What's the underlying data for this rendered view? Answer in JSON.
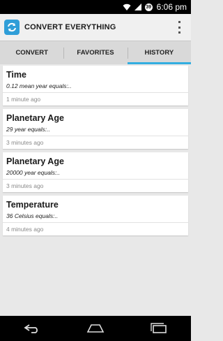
{
  "status_bar": {
    "battery_level": "39",
    "time": "6:06 pm"
  },
  "app": {
    "title": "CONVERT EVERYTHING",
    "accent_color": "#33aee0"
  },
  "tabs": [
    {
      "label": "CONVERT",
      "active": false
    },
    {
      "label": "FAVORITES",
      "active": false
    },
    {
      "label": "HISTORY",
      "active": true
    }
  ],
  "history": [
    {
      "title": "Time",
      "description": "0.12 mean year equals:..",
      "time": "1 minute ago"
    },
    {
      "title": "Planetary Age",
      "description": "29 year equals:..",
      "time": "3 minutes ago"
    },
    {
      "title": "Planetary Age",
      "description": "20000 year equals:..",
      "time": "3 minutes ago"
    },
    {
      "title": "Temperature",
      "description": "36 Celsius equals:..",
      "time": "4 minutes ago"
    }
  ],
  "icons": {
    "back": "back-icon",
    "home": "home-icon",
    "recents": "recents-icon",
    "overflow": "overflow-menu-icon"
  }
}
